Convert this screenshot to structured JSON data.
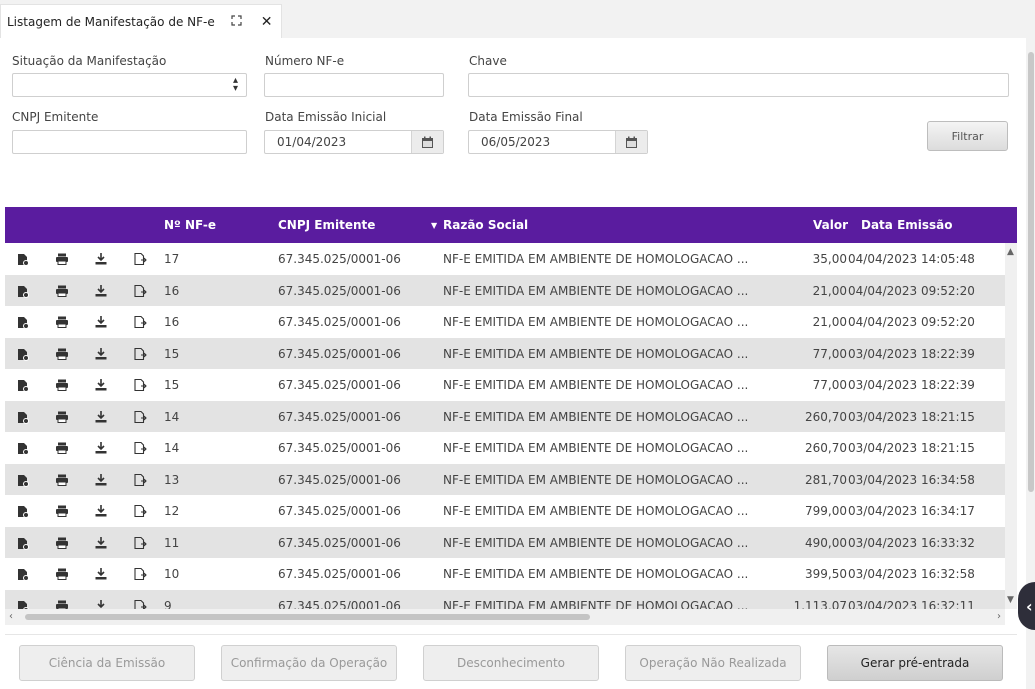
{
  "tab": {
    "title": "Listagem de Manifestação de NF-e",
    "expand_icon": "expand-icon",
    "close_icon": "close-icon"
  },
  "filters": {
    "situacao": {
      "label": "Situação da Manifestação",
      "value": ""
    },
    "numero": {
      "label": "Número NF-e",
      "value": ""
    },
    "chave": {
      "label": "Chave",
      "value": ""
    },
    "cnpj": {
      "label": "CNPJ Emitente",
      "value": ""
    },
    "data_inicial": {
      "label": "Data Emissão Inicial",
      "value": "01/04/2023"
    },
    "data_final": {
      "label": "Data Emissão Final",
      "value": "06/05/2023"
    },
    "filter_button": "Filtrar"
  },
  "grid": {
    "columns": {
      "numero": "Nº NF-e",
      "cnpj": "CNPJ Emitente",
      "razao": "Razão Social",
      "valor": "Valor",
      "data": "Data Emissão"
    },
    "sort_indicator": "▼",
    "row_icons": [
      "document-icon",
      "print-icon",
      "download-icon",
      "export-icon"
    ],
    "rows": [
      {
        "numero": "17",
        "cnpj": "67.345.025/0001-06",
        "razao": "NF-E EMITIDA EM AMBIENTE DE HOMOLOGACAO ...",
        "valor": "35,00",
        "data": "04/04/2023 14:05:48"
      },
      {
        "numero": "16",
        "cnpj": "67.345.025/0001-06",
        "razao": "NF-E EMITIDA EM AMBIENTE DE HOMOLOGACAO ...",
        "valor": "21,00",
        "data": "04/04/2023 09:52:20"
      },
      {
        "numero": "16",
        "cnpj": "67.345.025/0001-06",
        "razao": "NF-E EMITIDA EM AMBIENTE DE HOMOLOGACAO ...",
        "valor": "21,00",
        "data": "04/04/2023 09:52:20"
      },
      {
        "numero": "15",
        "cnpj": "67.345.025/0001-06",
        "razao": "NF-E EMITIDA EM AMBIENTE DE HOMOLOGACAO ...",
        "valor": "77,00",
        "data": "03/04/2023 18:22:39"
      },
      {
        "numero": "15",
        "cnpj": "67.345.025/0001-06",
        "razao": "NF-E EMITIDA EM AMBIENTE DE HOMOLOGACAO ...",
        "valor": "77,00",
        "data": "03/04/2023 18:22:39"
      },
      {
        "numero": "14",
        "cnpj": "67.345.025/0001-06",
        "razao": "NF-E EMITIDA EM AMBIENTE DE HOMOLOGACAO ...",
        "valor": "260,70",
        "data": "03/04/2023 18:21:15"
      },
      {
        "numero": "14",
        "cnpj": "67.345.025/0001-06",
        "razao": "NF-E EMITIDA EM AMBIENTE DE HOMOLOGACAO ...",
        "valor": "260,70",
        "data": "03/04/2023 18:21:15"
      },
      {
        "numero": "13",
        "cnpj": "67.345.025/0001-06",
        "razao": "NF-E EMITIDA EM AMBIENTE DE HOMOLOGACAO ...",
        "valor": "281,70",
        "data": "03/04/2023 16:34:58"
      },
      {
        "numero": "12",
        "cnpj": "67.345.025/0001-06",
        "razao": "NF-E EMITIDA EM AMBIENTE DE HOMOLOGACAO ...",
        "valor": "799,00",
        "data": "03/04/2023 16:34:17"
      },
      {
        "numero": "11",
        "cnpj": "67.345.025/0001-06",
        "razao": "NF-E EMITIDA EM AMBIENTE DE HOMOLOGACAO ...",
        "valor": "490,00",
        "data": "03/04/2023 16:33:32"
      },
      {
        "numero": "10",
        "cnpj": "67.345.025/0001-06",
        "razao": "NF-E EMITIDA EM AMBIENTE DE HOMOLOGACAO ...",
        "valor": "399,50",
        "data": "03/04/2023 16:32:58"
      },
      {
        "numero": "9",
        "cnpj": "67.345.025/0001-06",
        "razao": "NF-E EMITIDA EM AMBIENTE DE HOMOLOGACAO ...",
        "valor": "1.113,07",
        "data": "03/04/2023 16:32:11"
      }
    ]
  },
  "actions": {
    "ciencia": "Ciência da Emissão",
    "confirmacao": "Confirmação da Operação",
    "desconhecimento": "Desconhecimento",
    "nao_realizada": "Operação Não Realizada",
    "pre_entrada": "Gerar pré-entrada"
  },
  "colors": {
    "header_bg": "#5a1c9f",
    "row_alt": "#e3e3e3"
  },
  "side_toggle_icon": "chevron-left-icon"
}
